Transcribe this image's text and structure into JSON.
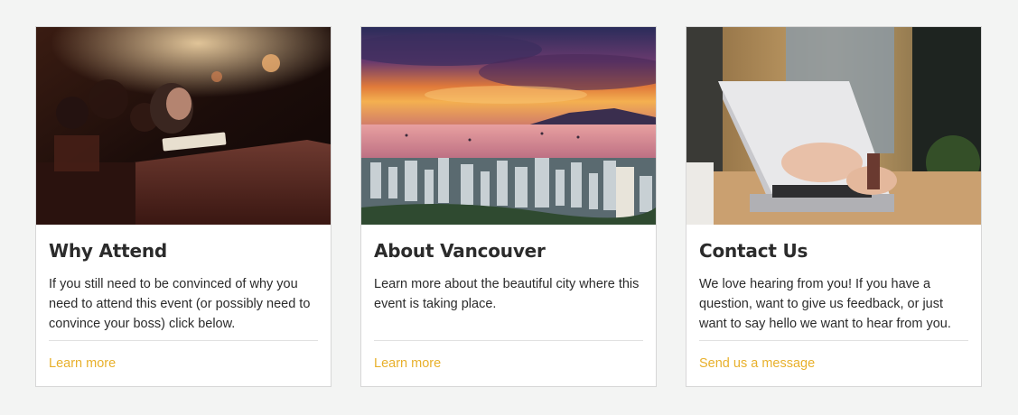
{
  "cards": [
    {
      "title": "Why Attend",
      "body": "If you still need to be convinced of why you need to attend this event (or possibly need to convince your boss) click below.",
      "link": "Learn more",
      "image": "auditorium-audience-photo"
    },
    {
      "title": "About Vancouver",
      "body": "Learn more about the beautiful city where this event is taking place.",
      "link": "Learn more",
      "image": "vancouver-sunset-skyline-photo"
    },
    {
      "title": "Contact Us",
      "body": "We love hearing from you! If you have a question, want to give us feedback, or just want to say hello we want to hear from you.",
      "link": "Send us a message",
      "image": "laptop-typing-photo"
    }
  ],
  "colors": {
    "background": "#f3f4f3",
    "card": "#ffffff",
    "text": "#2b2b2b",
    "accent_link": "#e8b02c",
    "divider": "#e1e1e1"
  }
}
